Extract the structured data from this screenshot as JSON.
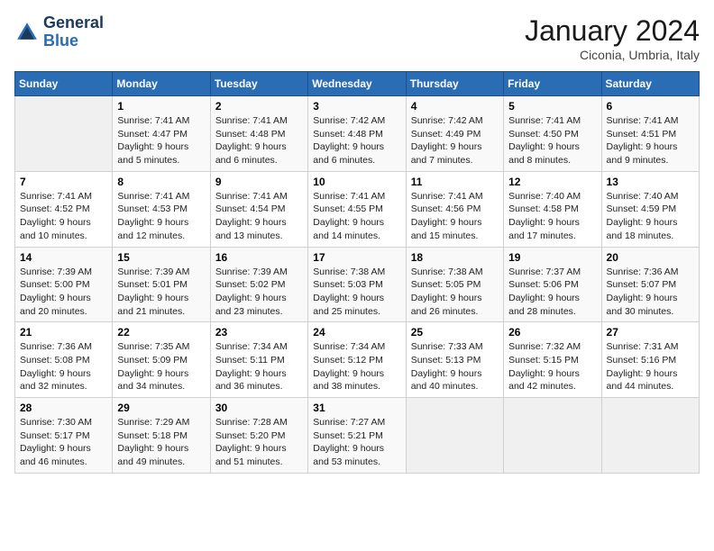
{
  "header": {
    "logo_line1": "General",
    "logo_line2": "Blue",
    "month": "January 2024",
    "location": "Ciconia, Umbria, Italy"
  },
  "days_of_week": [
    "Sunday",
    "Monday",
    "Tuesday",
    "Wednesday",
    "Thursday",
    "Friday",
    "Saturday"
  ],
  "weeks": [
    [
      {
        "num": "",
        "info": ""
      },
      {
        "num": "1",
        "info": "Sunrise: 7:41 AM\nSunset: 4:47 PM\nDaylight: 9 hours\nand 5 minutes."
      },
      {
        "num": "2",
        "info": "Sunrise: 7:41 AM\nSunset: 4:48 PM\nDaylight: 9 hours\nand 6 minutes."
      },
      {
        "num": "3",
        "info": "Sunrise: 7:42 AM\nSunset: 4:48 PM\nDaylight: 9 hours\nand 6 minutes."
      },
      {
        "num": "4",
        "info": "Sunrise: 7:42 AM\nSunset: 4:49 PM\nDaylight: 9 hours\nand 7 minutes."
      },
      {
        "num": "5",
        "info": "Sunrise: 7:41 AM\nSunset: 4:50 PM\nDaylight: 9 hours\nand 8 minutes."
      },
      {
        "num": "6",
        "info": "Sunrise: 7:41 AM\nSunset: 4:51 PM\nDaylight: 9 hours\nand 9 minutes."
      }
    ],
    [
      {
        "num": "7",
        "info": "Sunrise: 7:41 AM\nSunset: 4:52 PM\nDaylight: 9 hours\nand 10 minutes."
      },
      {
        "num": "8",
        "info": "Sunrise: 7:41 AM\nSunset: 4:53 PM\nDaylight: 9 hours\nand 12 minutes."
      },
      {
        "num": "9",
        "info": "Sunrise: 7:41 AM\nSunset: 4:54 PM\nDaylight: 9 hours\nand 13 minutes."
      },
      {
        "num": "10",
        "info": "Sunrise: 7:41 AM\nSunset: 4:55 PM\nDaylight: 9 hours\nand 14 minutes."
      },
      {
        "num": "11",
        "info": "Sunrise: 7:41 AM\nSunset: 4:56 PM\nDaylight: 9 hours\nand 15 minutes."
      },
      {
        "num": "12",
        "info": "Sunrise: 7:40 AM\nSunset: 4:58 PM\nDaylight: 9 hours\nand 17 minutes."
      },
      {
        "num": "13",
        "info": "Sunrise: 7:40 AM\nSunset: 4:59 PM\nDaylight: 9 hours\nand 18 minutes."
      }
    ],
    [
      {
        "num": "14",
        "info": "Sunrise: 7:39 AM\nSunset: 5:00 PM\nDaylight: 9 hours\nand 20 minutes."
      },
      {
        "num": "15",
        "info": "Sunrise: 7:39 AM\nSunset: 5:01 PM\nDaylight: 9 hours\nand 21 minutes."
      },
      {
        "num": "16",
        "info": "Sunrise: 7:39 AM\nSunset: 5:02 PM\nDaylight: 9 hours\nand 23 minutes."
      },
      {
        "num": "17",
        "info": "Sunrise: 7:38 AM\nSunset: 5:03 PM\nDaylight: 9 hours\nand 25 minutes."
      },
      {
        "num": "18",
        "info": "Sunrise: 7:38 AM\nSunset: 5:05 PM\nDaylight: 9 hours\nand 26 minutes."
      },
      {
        "num": "19",
        "info": "Sunrise: 7:37 AM\nSunset: 5:06 PM\nDaylight: 9 hours\nand 28 minutes."
      },
      {
        "num": "20",
        "info": "Sunrise: 7:36 AM\nSunset: 5:07 PM\nDaylight: 9 hours\nand 30 minutes."
      }
    ],
    [
      {
        "num": "21",
        "info": "Sunrise: 7:36 AM\nSunset: 5:08 PM\nDaylight: 9 hours\nand 32 minutes."
      },
      {
        "num": "22",
        "info": "Sunrise: 7:35 AM\nSunset: 5:09 PM\nDaylight: 9 hours\nand 34 minutes."
      },
      {
        "num": "23",
        "info": "Sunrise: 7:34 AM\nSunset: 5:11 PM\nDaylight: 9 hours\nand 36 minutes."
      },
      {
        "num": "24",
        "info": "Sunrise: 7:34 AM\nSunset: 5:12 PM\nDaylight: 9 hours\nand 38 minutes."
      },
      {
        "num": "25",
        "info": "Sunrise: 7:33 AM\nSunset: 5:13 PM\nDaylight: 9 hours\nand 40 minutes."
      },
      {
        "num": "26",
        "info": "Sunrise: 7:32 AM\nSunset: 5:15 PM\nDaylight: 9 hours\nand 42 minutes."
      },
      {
        "num": "27",
        "info": "Sunrise: 7:31 AM\nSunset: 5:16 PM\nDaylight: 9 hours\nand 44 minutes."
      }
    ],
    [
      {
        "num": "28",
        "info": "Sunrise: 7:30 AM\nSunset: 5:17 PM\nDaylight: 9 hours\nand 46 minutes."
      },
      {
        "num": "29",
        "info": "Sunrise: 7:29 AM\nSunset: 5:18 PM\nDaylight: 9 hours\nand 49 minutes."
      },
      {
        "num": "30",
        "info": "Sunrise: 7:28 AM\nSunset: 5:20 PM\nDaylight: 9 hours\nand 51 minutes."
      },
      {
        "num": "31",
        "info": "Sunrise: 7:27 AM\nSunset: 5:21 PM\nDaylight: 9 hours\nand 53 minutes."
      },
      {
        "num": "",
        "info": ""
      },
      {
        "num": "",
        "info": ""
      },
      {
        "num": "",
        "info": ""
      }
    ]
  ]
}
